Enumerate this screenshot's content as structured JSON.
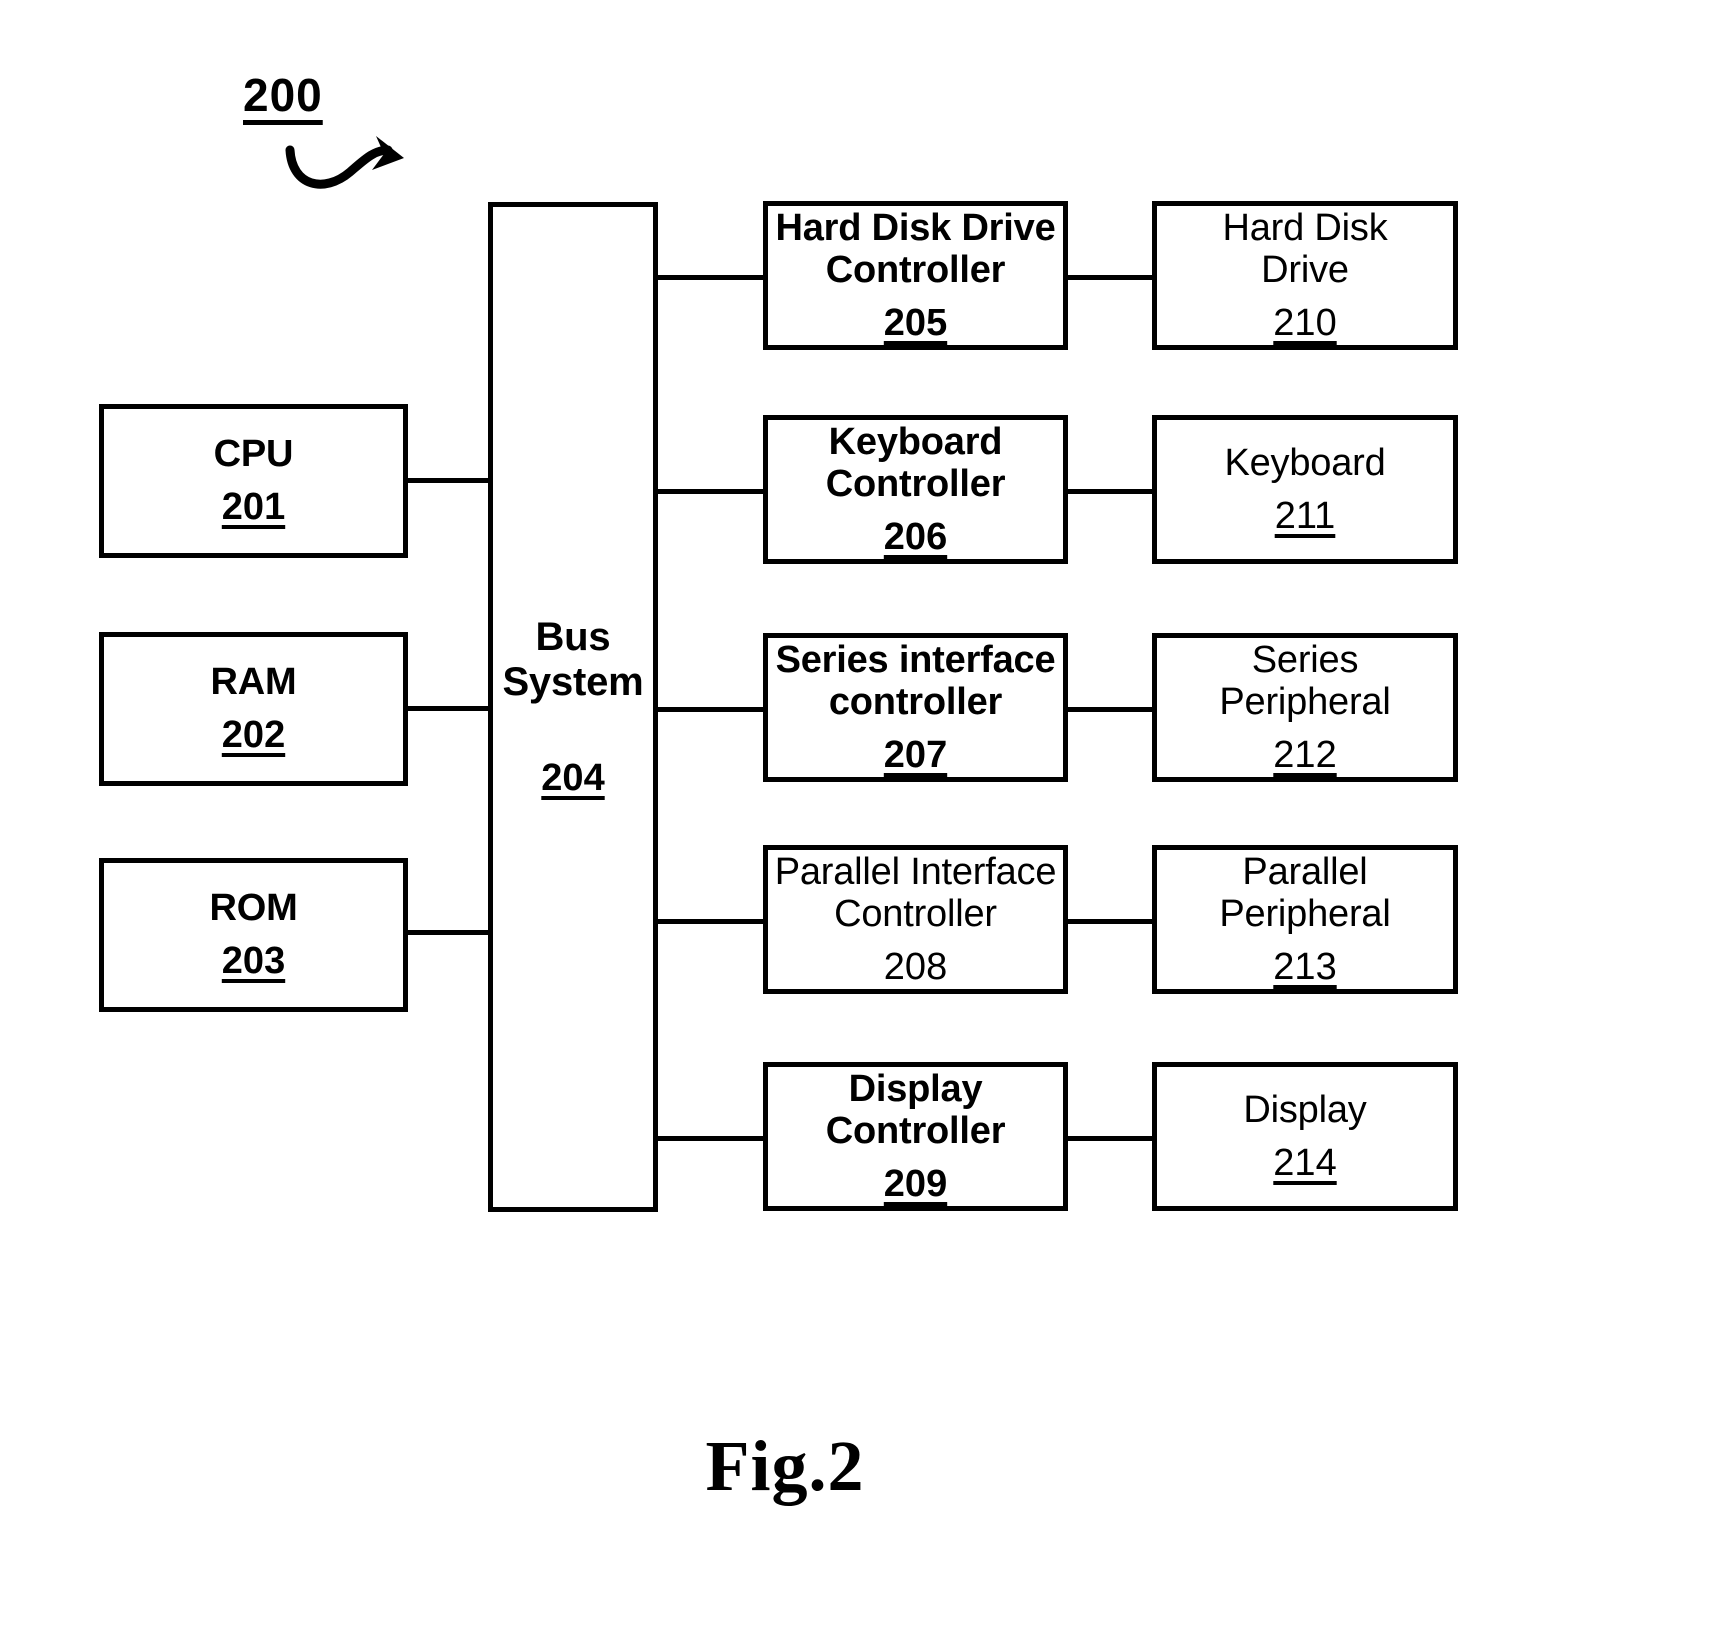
{
  "figure": {
    "ref_label": "200",
    "caption": "Fig.2",
    "lead_arrow_icon": "curved-arrow-icon"
  },
  "blocks": {
    "cpu": {
      "title": "CPU",
      "ref": "201"
    },
    "ram": {
      "title": "RAM",
      "ref": "202"
    },
    "rom": {
      "title": "ROM",
      "ref": "203"
    },
    "bus": {
      "title": "Bus\nSystem",
      "ref": "204"
    },
    "hdd_controller": {
      "title": "Hard Disk Drive\nController",
      "ref": "205"
    },
    "keyboard_controller": {
      "title": "Keyboard\nController",
      "ref": "206"
    },
    "series_controller": {
      "title": "Series interface\ncontroller",
      "ref": "207"
    },
    "parallel_controller": {
      "title": "Parallel Interface\nController",
      "ref": "208"
    },
    "display_controller": {
      "title": "Display\nController",
      "ref": "209"
    },
    "hard_disk_drive": {
      "title": "Hard Disk\nDrive",
      "ref": "210"
    },
    "keyboard": {
      "title": "Keyboard",
      "ref": "211"
    },
    "series_peripheral": {
      "title": "Series\nPeripheral",
      "ref": "212"
    },
    "parallel_peripheral": {
      "title": "Parallel\nPeripheral",
      "ref": "213"
    },
    "display": {
      "title": "Display",
      "ref": "214"
    }
  },
  "colors": {
    "stroke": "#000000",
    "background": "#ffffff"
  }
}
